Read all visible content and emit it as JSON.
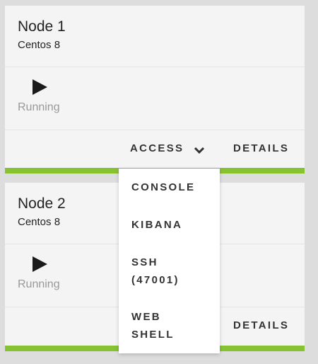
{
  "colors": {
    "background": "#dddddd",
    "card": "#f4f4f4",
    "accent": "#86c232",
    "muted_text": "#999999",
    "text": "#333333"
  },
  "nodes": [
    {
      "title": "Node 1",
      "os": "Centos 8",
      "status_icon": "play-icon",
      "status": "Running",
      "access_label": "ACCESS",
      "details_label": "DETAILS"
    },
    {
      "title": "Node 2",
      "os": "Centos 8",
      "status_icon": "play-icon",
      "status": "Running",
      "details_label": "DETAILS"
    }
  ],
  "access_menu": {
    "icon": "chevron-down-icon",
    "items": [
      {
        "label": "CONSOLE"
      },
      {
        "label": "KIBANA"
      },
      {
        "label": "SSH (47001)"
      },
      {
        "label": "WEB SHELL"
      }
    ]
  }
}
